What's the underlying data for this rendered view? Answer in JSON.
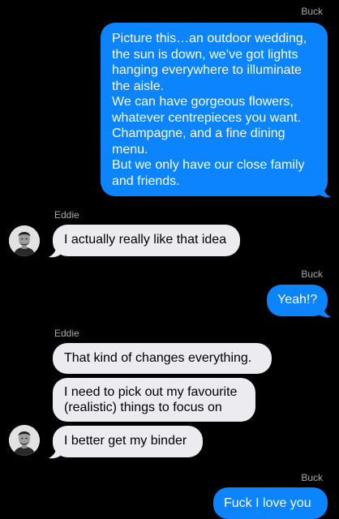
{
  "colors": {
    "background": "#000000",
    "outgoing_bubble": "#0b84fe",
    "incoming_bubble": "#ebebf0",
    "sender_name": "#a9a9ad"
  },
  "conversation": {
    "messages": [
      {
        "sender": "Buck",
        "direction": "outgoing",
        "lines": [
          "Picture this…an outdoor wedding,",
          "the sun is down, we’ve got lights",
          "hanging everywhere to illuminate",
          "the aisle.",
          "We can have gorgeous flowers,",
          "whatever centrepieces you want.",
          "Champagne, and a fine dining",
          "menu.",
          "But we only have our close family",
          "and friends."
        ]
      },
      {
        "sender": "Eddie",
        "direction": "incoming",
        "lines": [
          "I actually really like that idea"
        ]
      },
      {
        "sender": "Buck",
        "direction": "outgoing",
        "lines": [
          "Yeah!?"
        ]
      },
      {
        "sender": "Eddie",
        "direction": "incoming",
        "lines": [
          "That kind of changes everything."
        ]
      },
      {
        "sender": "Eddie",
        "direction": "incoming",
        "lines": [
          "I need to pick out my favourite",
          "(realistic) things to focus on"
        ]
      },
      {
        "sender": "Eddie",
        "direction": "incoming",
        "lines": [
          "I better get my binder"
        ]
      },
      {
        "sender": "Buck",
        "direction": "outgoing",
        "lines": [
          "Fuck I love you"
        ]
      }
    ]
  }
}
